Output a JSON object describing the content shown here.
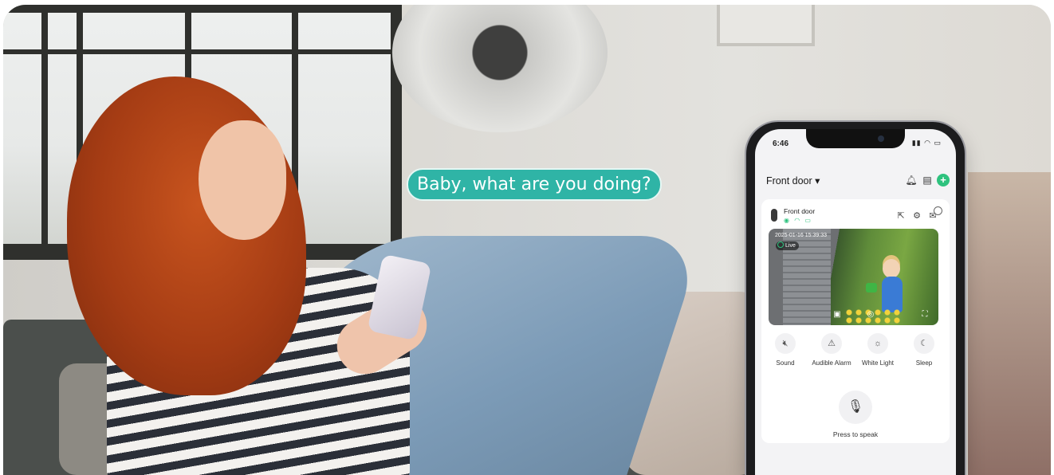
{
  "speech_bubble": {
    "text": "Baby, what are you doing?",
    "color": "#2fb4a6"
  },
  "phone": {
    "status_bar": {
      "time": "6:46"
    },
    "header": {
      "title": "Front door ▾"
    },
    "device": {
      "name": "Front door",
      "video": {
        "timestamp": "2025-01-16 15:39:33",
        "live_label": "Live"
      }
    },
    "controls": [
      {
        "label": "Sound",
        "icon": "speaker-muted-icon"
      },
      {
        "label": "Audible Alarm",
        "icon": "alarm-siren-icon"
      },
      {
        "label": "White Light",
        "icon": "light-bulb-icon"
      },
      {
        "label": "Sleep",
        "icon": "sleep-mode-icon"
      }
    ],
    "speak": {
      "label": "Press to speak",
      "icon": "microphone-icon"
    },
    "accent_color": "#2ec27e"
  }
}
